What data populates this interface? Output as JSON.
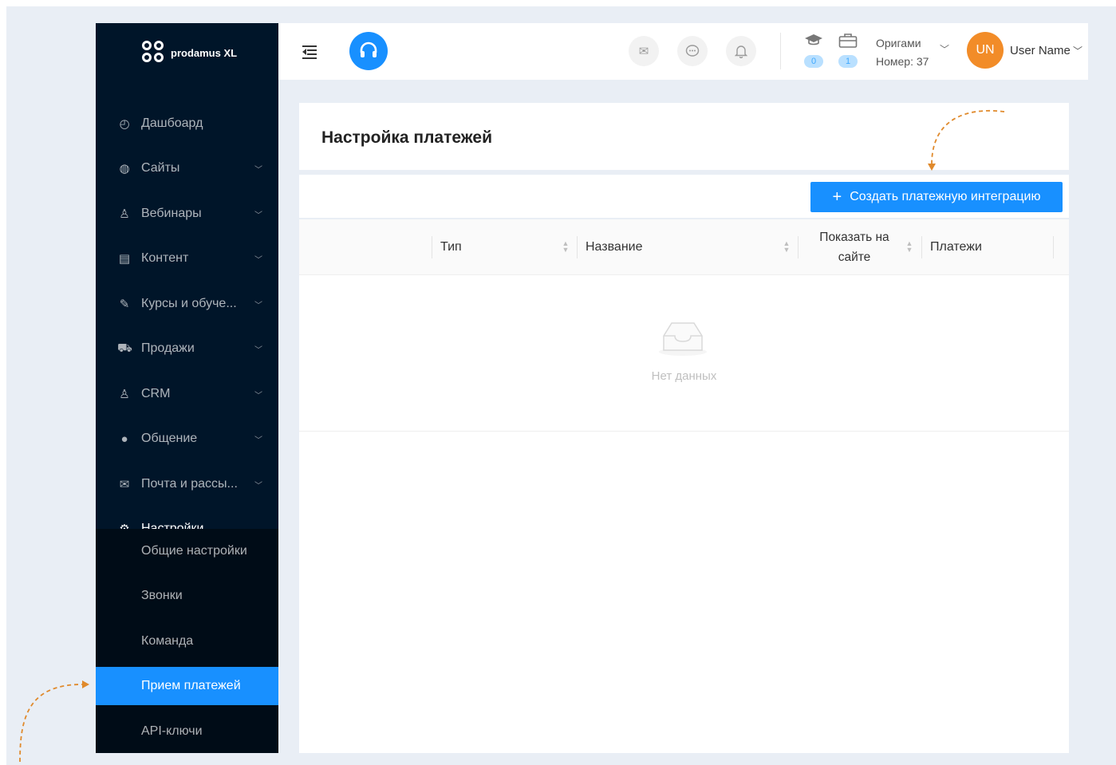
{
  "brand": {
    "logo_text": "prodamus XL"
  },
  "sidebar": {
    "items": [
      {
        "label": "Дашбоард",
        "icon": "dashboard-icon",
        "glyph": "◴",
        "has_arrow": false
      },
      {
        "label": "Сайты",
        "icon": "globe-icon",
        "glyph": "◍",
        "has_arrow": true
      },
      {
        "label": "Вебинары",
        "icon": "webinar-icon",
        "glyph": "♙",
        "has_arrow": true
      },
      {
        "label": "Контент",
        "icon": "content-icon",
        "glyph": "▤",
        "has_arrow": true
      },
      {
        "label": "Курсы и обуче...",
        "icon": "edit-icon",
        "glyph": "✎",
        "has_arrow": true
      },
      {
        "label": "Продажи",
        "icon": "cart-icon",
        "glyph": "⛟",
        "has_arrow": true
      },
      {
        "label": "CRM",
        "icon": "user-icon",
        "glyph": "♙",
        "has_arrow": true
      },
      {
        "label": "Общение",
        "icon": "chat-icon",
        "glyph": "●",
        "has_arrow": true
      },
      {
        "label": "Почта и рассы...",
        "icon": "mail-icon",
        "glyph": "✉",
        "has_arrow": true
      },
      {
        "label": "Настройки",
        "icon": "settings-icon",
        "glyph": "⚙",
        "has_arrow": true,
        "open": true
      }
    ],
    "subitems": [
      {
        "label": "Общие настройки",
        "active": false
      },
      {
        "label": "Звонки",
        "active": false
      },
      {
        "label": "Команда",
        "active": false
      },
      {
        "label": "Прием платежей",
        "active": true
      },
      {
        "label": "API-ключи",
        "active": false
      }
    ]
  },
  "header": {
    "stats": [
      {
        "icon": "graduation-cap-icon",
        "count": "0"
      },
      {
        "icon": "briefcase-icon",
        "count": "1"
      }
    ],
    "company": {
      "name": "Оригами",
      "number": "Номер: 37"
    },
    "user": {
      "initials": "UN",
      "name": "User Name"
    }
  },
  "page": {
    "title": "Настройка платежей",
    "create_button": "Создать платежную интеграцию"
  },
  "table": {
    "columns": [
      {
        "label": "Тип",
        "sortable": true
      },
      {
        "label": "Название",
        "sortable": true
      },
      {
        "label": "Показать на сайте",
        "sortable": true
      },
      {
        "label": "Платежи",
        "sortable": false
      }
    ],
    "rows": [],
    "empty_text": "Нет данных"
  },
  "colors": {
    "sidebar_bg": "#001529",
    "submenu_bg": "#000c17",
    "accent": "#1890ff",
    "avatar": "#f28c28",
    "annotation_arrow": "#e08a2c"
  }
}
